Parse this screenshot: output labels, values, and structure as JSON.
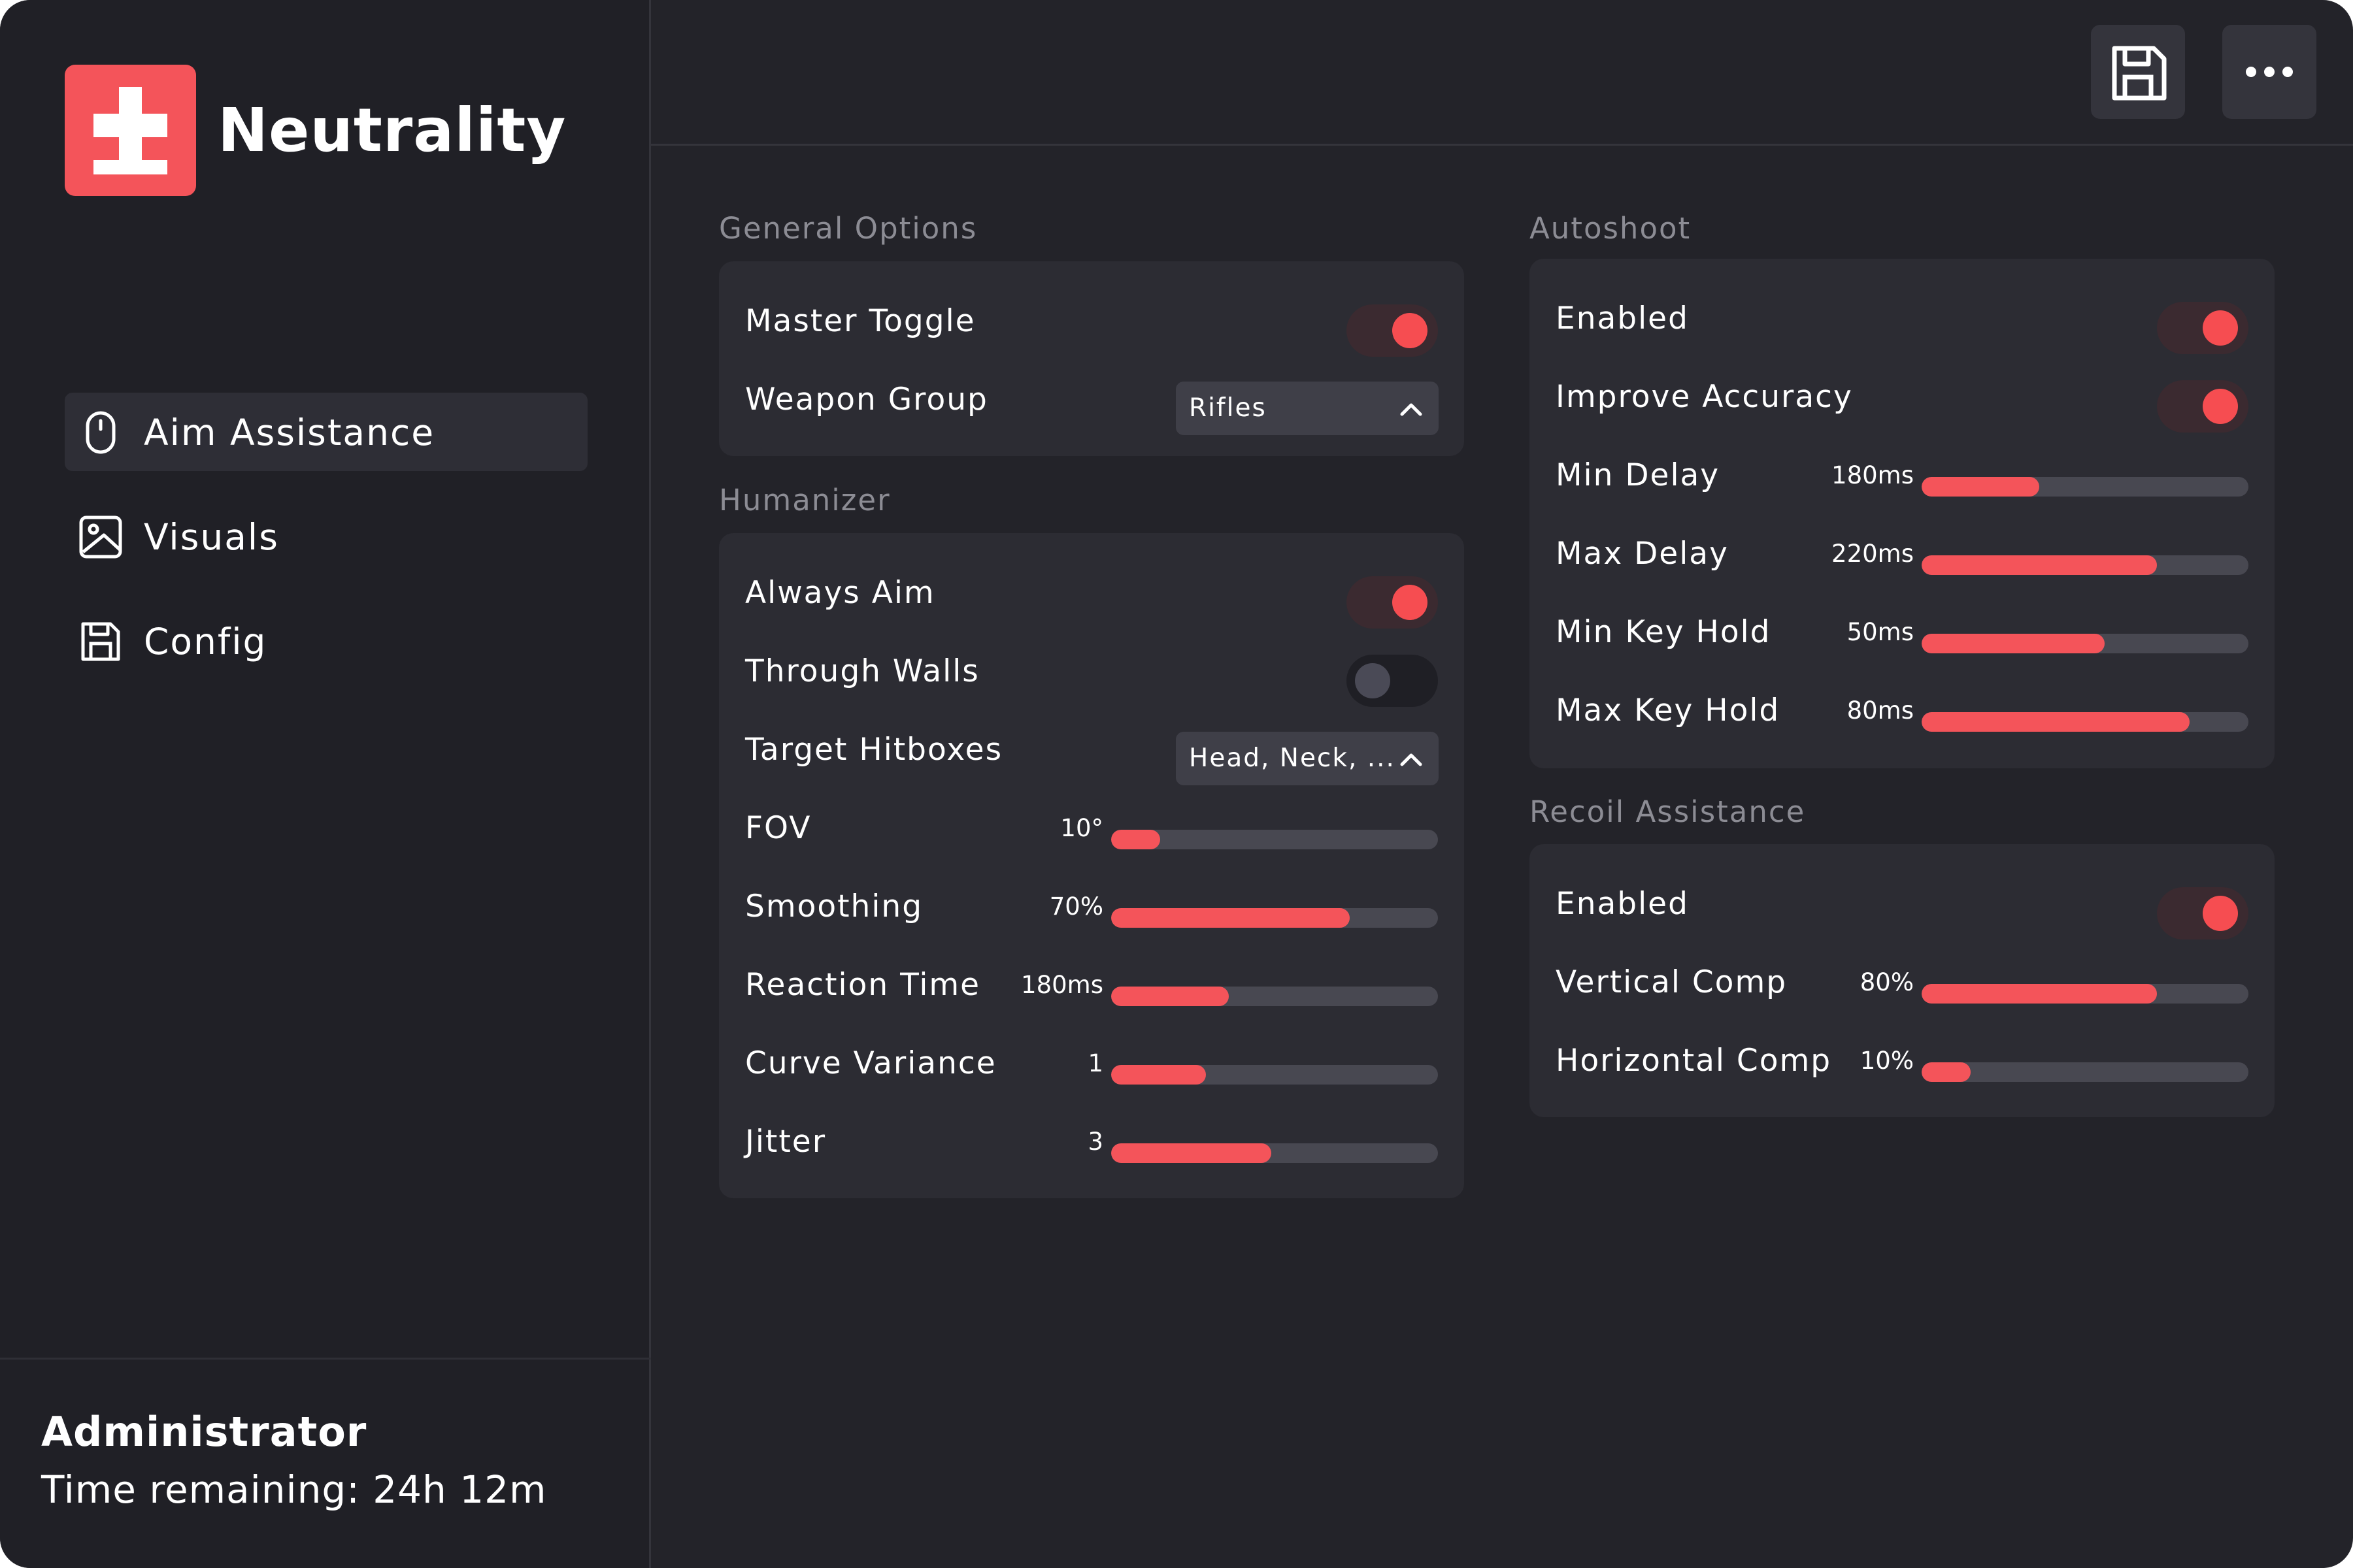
{
  "app": {
    "name": "Neutrality",
    "logo": "logo-cross-icon"
  },
  "colors": {
    "accent": "#f4545a",
    "window_bg": "#232329",
    "sidebar_bg": "#202026",
    "card_bg": "#2c2c33",
    "track_bg": "#484851"
  },
  "toolbar": {
    "save_icon": "floppy-disk-icon",
    "more_icon": "more-horizontal-icon"
  },
  "sidebar": {
    "items": [
      {
        "label": "Aim Assistance",
        "icon": "mouse-icon",
        "active": true
      },
      {
        "label": "Visuals",
        "icon": "image-icon",
        "active": false
      },
      {
        "label": "Config",
        "icon": "floppy-disk-icon",
        "active": false
      }
    ]
  },
  "user": {
    "name": "Administrator",
    "time_remaining": "Time remaining: 24h 12m"
  },
  "general": {
    "title": "General Options",
    "master_toggle": {
      "label": "Master Toggle",
      "on": true
    },
    "weapon_group": {
      "label": "Weapon Group",
      "value": "Rifles"
    }
  },
  "humanizer": {
    "title": "Humanizer",
    "always_aim": {
      "label": "Always Aim",
      "on": true
    },
    "through_walls": {
      "label": "Through Walls",
      "on": false
    },
    "target_hitboxes": {
      "label": "Target Hitboxes",
      "value": "Head, Neck, ..."
    },
    "sliders": [
      {
        "label": "FOV",
        "value": "10°",
        "fill": 0.15
      },
      {
        "label": "Smoothing",
        "value": "70%",
        "fill": 0.73
      },
      {
        "label": "Reaction Time",
        "value": "180ms",
        "fill": 0.36
      },
      {
        "label": "Curve Variance",
        "value": "1",
        "fill": 0.29
      },
      {
        "label": "Jitter",
        "value": "3",
        "fill": 0.49
      }
    ]
  },
  "autoshoot": {
    "title": "Autoshoot",
    "enabled": {
      "label": "Enabled",
      "on": true
    },
    "improve_accuracy": {
      "label": "Improve Accuracy",
      "on": true
    },
    "sliders": [
      {
        "label": "Min Delay",
        "value": "180ms",
        "fill": 0.36
      },
      {
        "label": "Max Delay",
        "value": "220ms",
        "fill": 0.72
      },
      {
        "label": "Min Key Hold",
        "value": "50ms",
        "fill": 0.56
      },
      {
        "label": "Max Key Hold",
        "value": "80ms",
        "fill": 0.82
      }
    ]
  },
  "recoil": {
    "title": "Recoil Assistance",
    "enabled": {
      "label": "Enabled",
      "on": true
    },
    "sliders": [
      {
        "label": "Vertical Comp",
        "value": "80%",
        "fill": 0.72
      },
      {
        "label": "Horizontal Comp",
        "value": "10%",
        "fill": 0.15
      }
    ]
  }
}
